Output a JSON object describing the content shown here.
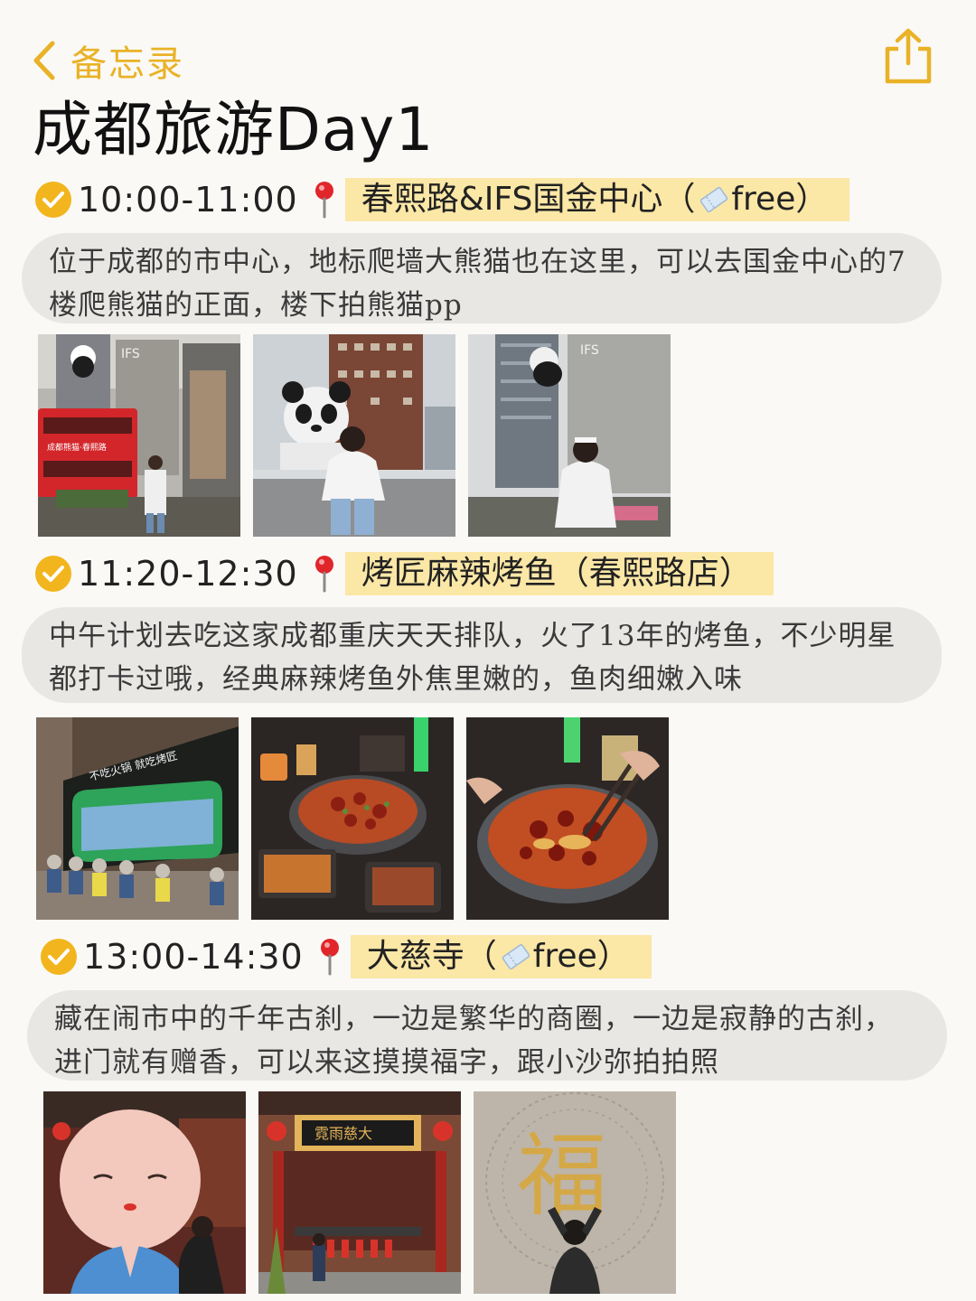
{
  "nav": {
    "back_label": "备忘录"
  },
  "title": "成都旅游Day1",
  "entries": [
    {
      "time": "10:00-11:00",
      "place": "春熙路&IFS国金中心（",
      "ticket": "free",
      "place_end": "）",
      "desc": "位于成都的市中心，地标爬墙大熊猫也在这里，可以去国金中心的7楼爬熊猫的正面，楼下拍熊猫pp"
    },
    {
      "time": "11:20-12:30",
      "place": "烤匠麻辣烤鱼（春熙路店）",
      "desc": "中午计划去吃这家成都重庆天天排队，火了13年的烤鱼，不少明星都打卡过哦，经典麻辣烤鱼外焦里嫩的，鱼肉细嫩入味"
    },
    {
      "time": "13:00-14:30",
      "place": "大慈寺（",
      "ticket": "free",
      "place_end": "）",
      "desc": "藏在闹市中的千年古刹，一边是繁华的商圈，一边是寂静的古刹，进门就有赠香，可以来这摸摸福字，跟小沙弥拍拍照"
    }
  ],
  "photo_text": {
    "ifs_sign": "IFS",
    "bus_banner": "成都熊猫·春熙路",
    "restaurant_sign": "不吃火锅 就吃烤匠",
    "temple_plaque": "霓雨慈大",
    "fu": "福"
  },
  "colors": {
    "accent": "#e9b227",
    "highlight": "#fbe7a6",
    "bubble": "#e8e7e4",
    "background": "#faf9f6"
  }
}
